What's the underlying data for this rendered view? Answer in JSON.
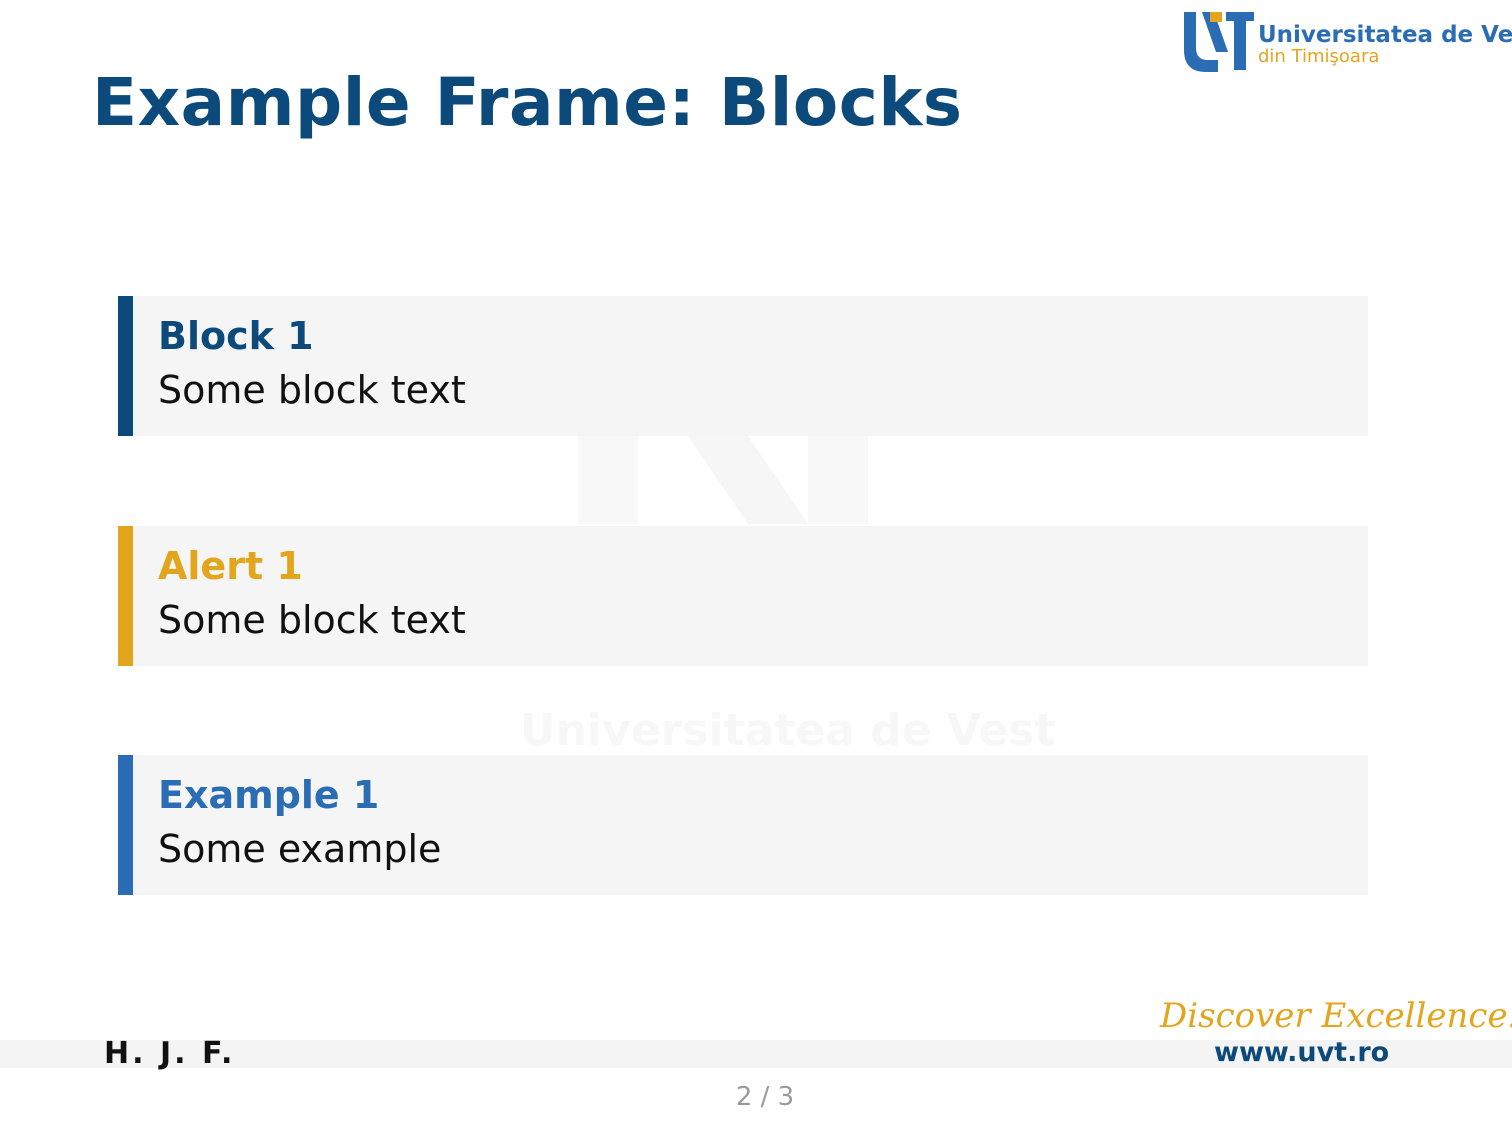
{
  "slide": {
    "title": "Example Frame: Blocks"
  },
  "logo": {
    "name_line1": "Universitatea de Vest",
    "name_line2": "din Timişoara",
    "mark_icon": "uvt-logo-mark-icon",
    "colors": {
      "blue": "#2a6db5",
      "gold": "#e2a51c"
    }
  },
  "watermark": {
    "text": "Universitatea de Vest",
    "mark_icon": "uvt-watermark-icon"
  },
  "blocks": [
    {
      "title": "Block 1",
      "body": "Some block text",
      "accent": "#0b4a7a"
    },
    {
      "title": "Alert 1",
      "body": "Some block text",
      "accent": "#e2a51c"
    },
    {
      "title": "Example 1",
      "body": "Some example",
      "accent": "#2a6db5"
    }
  ],
  "footer": {
    "author": "H. J. F.",
    "tagline": "Discover Excellence!",
    "url": "www.uvt.ro",
    "page_current": "2",
    "page_total": "3",
    "page_text": "2 / 3"
  }
}
